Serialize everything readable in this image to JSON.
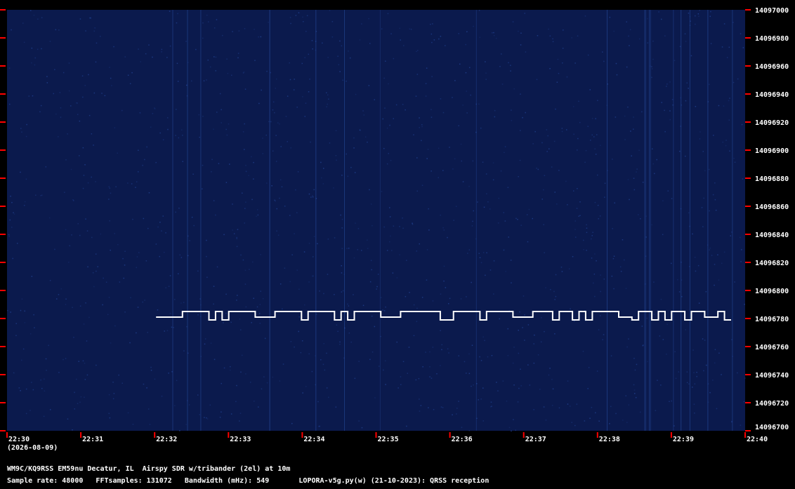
{
  "chart_data": {
    "type": "heatmap",
    "x_ticks": [
      "22:30",
      "22:31",
      "22:32",
      "22:33",
      "22:34",
      "22:35",
      "22:36",
      "22:37",
      "22:38",
      "22:39",
      "22:40"
    ],
    "x_date": "(2026-08-09)",
    "y_ticks": [
      14097000,
      14096980,
      14096960,
      14096940,
      14096920,
      14096900,
      14096880,
      14096860,
      14096840,
      14096820,
      14096800,
      14096780,
      14096760,
      14096740,
      14096720,
      14096700
    ],
    "ylim": [
      14096700,
      14097000
    ],
    "xlim": [
      "22:30",
      "22:40"
    ],
    "signal": {
      "start": "22:32",
      "end": "22:40",
      "freq_low": 14096781,
      "freq_high": 14096785,
      "freq_dip": 14096779,
      "color": "#ffffff"
    },
    "colors": {
      "background": "#0b1a4d",
      "noise": "#1e3d88",
      "text": "#ffffff",
      "tick": "#ff0000"
    }
  },
  "footer": {
    "line1": "WM9C/KQ9RSS EM59nu Decatur, IL  Airspy SDR w/tribander (2el) at 10m",
    "line2": "Sample rate: 48000   FFTsamples: 131072   Bandwidth (mHz): 549       LOPORA-v5g.py(w) (21-10-2023): QRSS reception"
  }
}
